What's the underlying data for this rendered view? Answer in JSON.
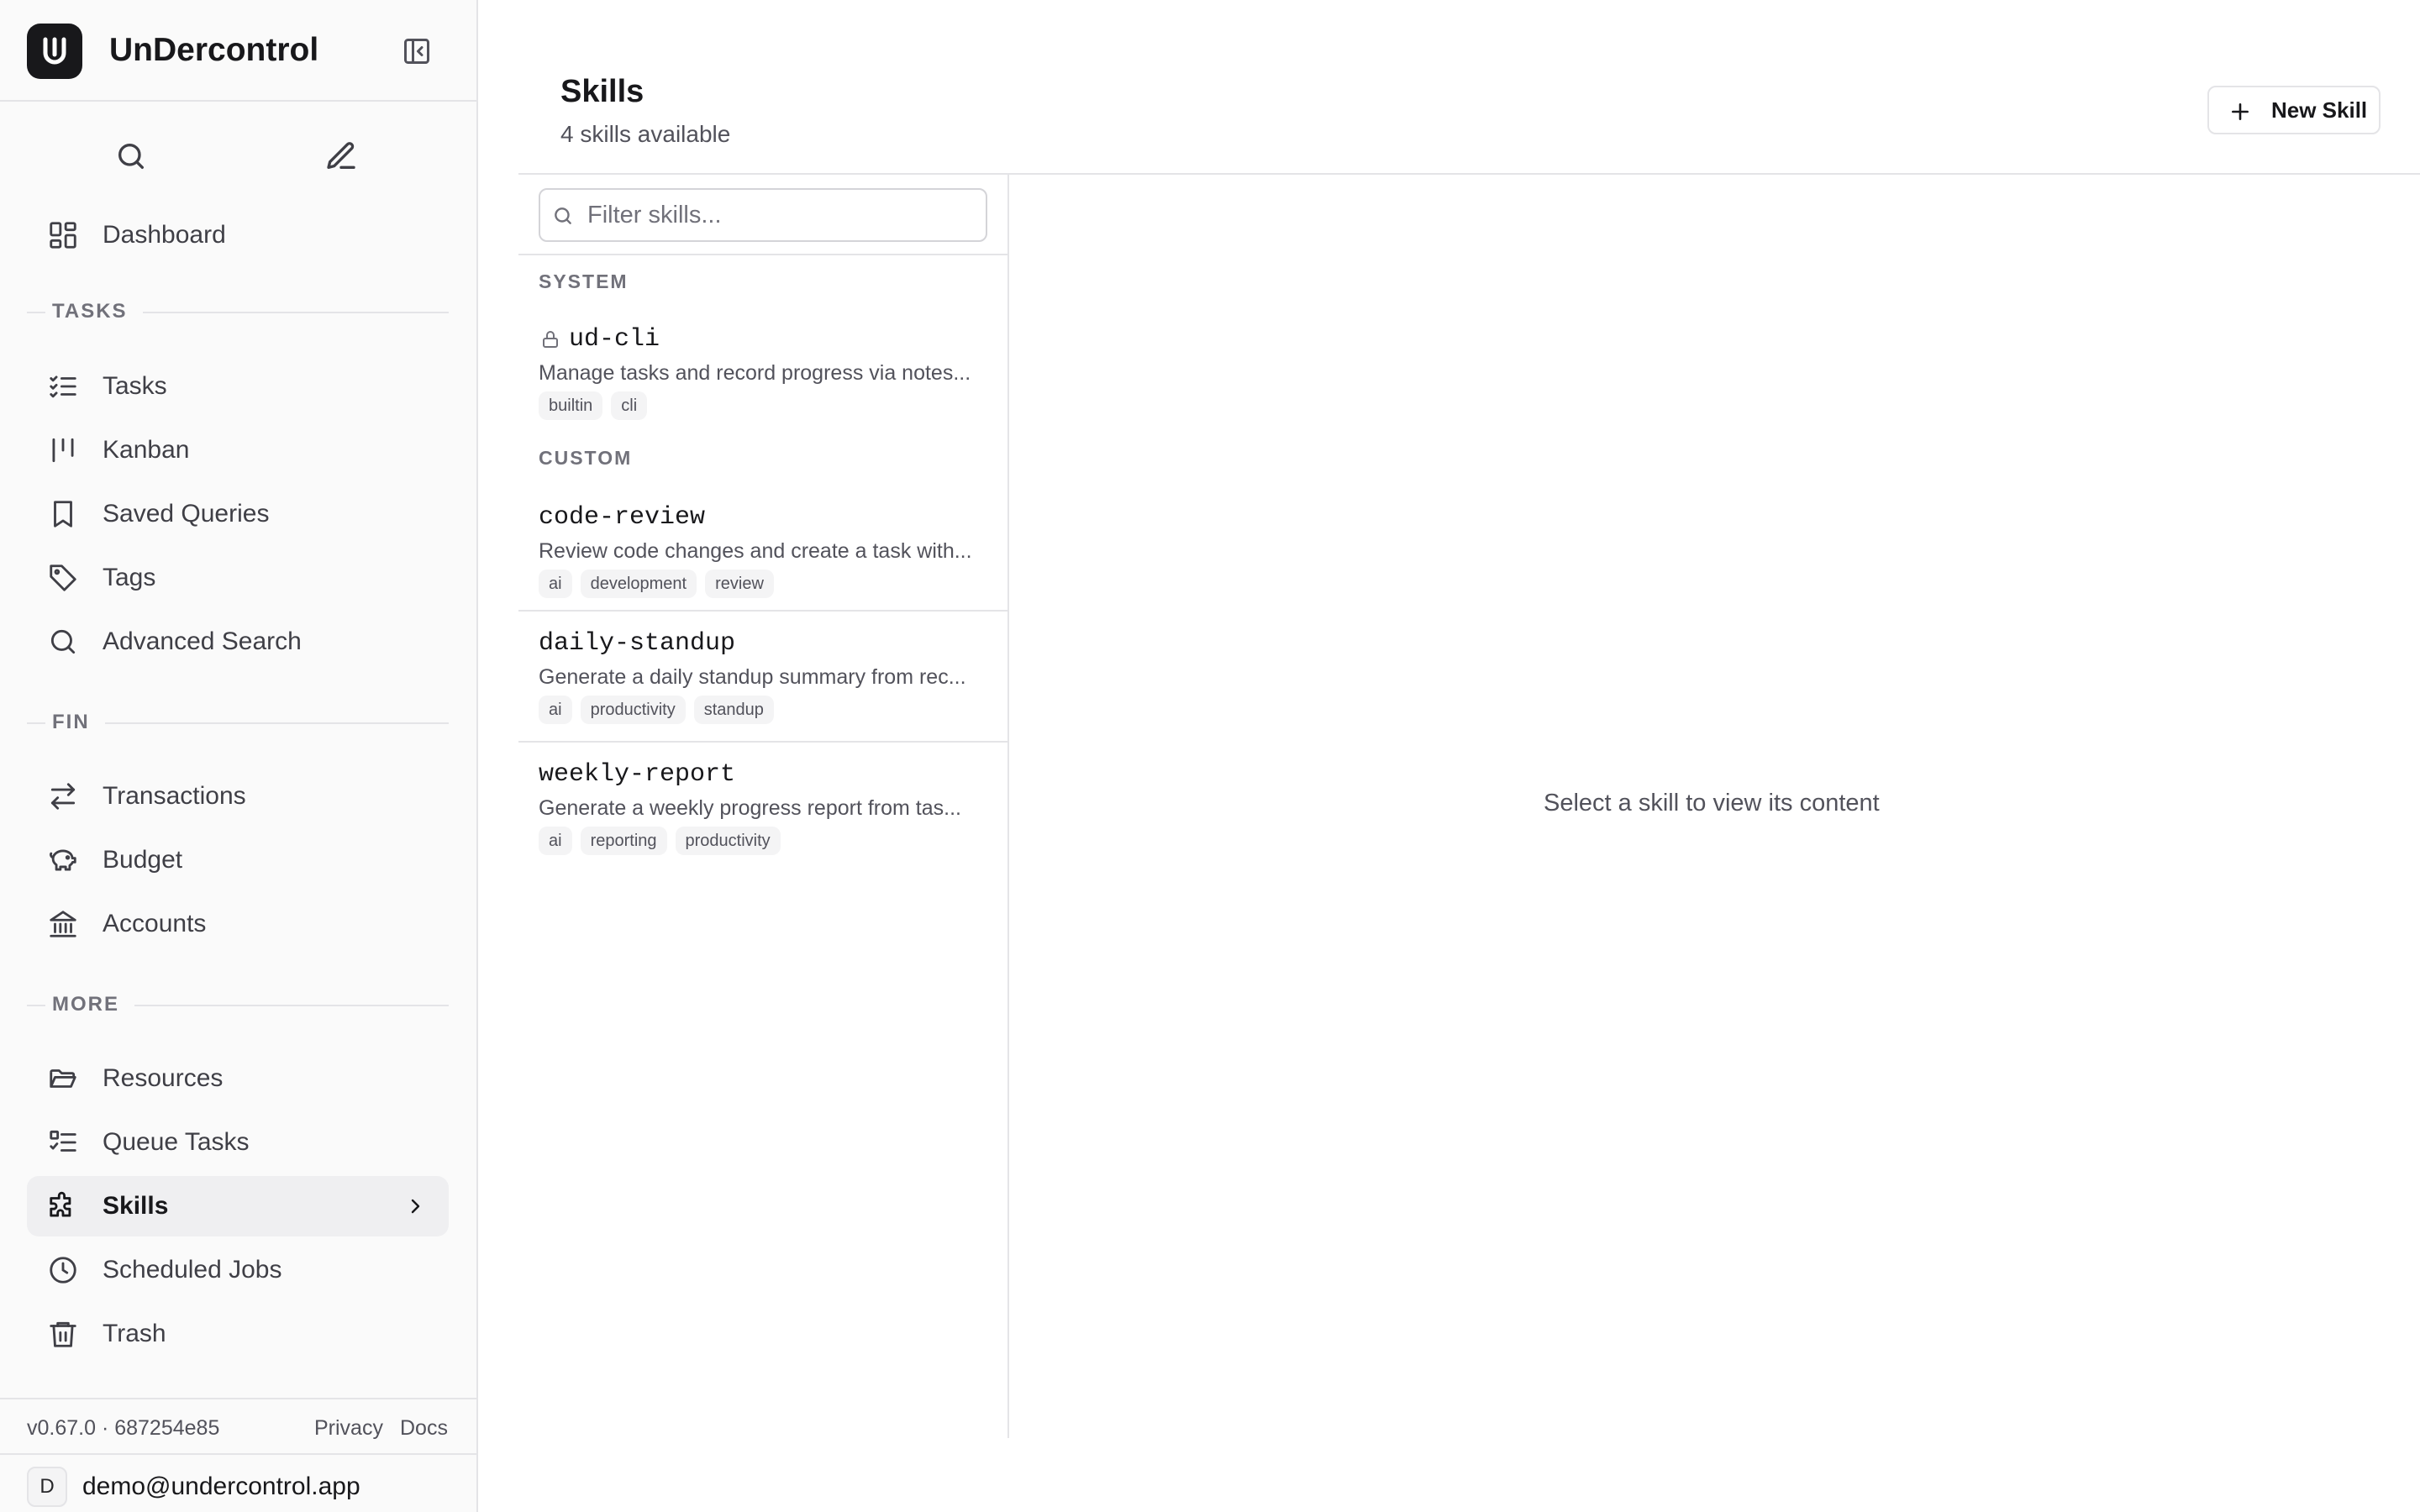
{
  "app": {
    "name": "UnDercontrol",
    "version": "v0.67.0 · 687254e85",
    "privacy_label": "Privacy",
    "docs_label": "Docs",
    "user_initial": "D",
    "user_email": "demo@undercontrol.app"
  },
  "sidebar": {
    "dashboard": "Dashboard",
    "sections": {
      "tasks": "TASKS",
      "fin": "FIN",
      "more": "MORE"
    },
    "tasks_items": [
      "Tasks",
      "Kanban",
      "Saved Queries",
      "Tags",
      "Advanced Search"
    ],
    "fin_items": [
      "Transactions",
      "Budget",
      "Accounts"
    ],
    "more_items": [
      "Resources",
      "Queue Tasks",
      "Skills",
      "Scheduled Jobs",
      "Trash"
    ],
    "active_item": "Skills"
  },
  "page": {
    "title": "Skills",
    "subtitle": "4 skills available",
    "new_button": "New Skill",
    "filter_placeholder": "Filter skills...",
    "empty_message": "Select a skill to view its content"
  },
  "skills": {
    "system_label": "SYSTEM",
    "custom_label": "CUSTOM",
    "system": [
      {
        "name": "ud-cli",
        "desc": "Manage tasks and record progress via notes...",
        "tags": [
          "builtin",
          "cli"
        ]
      }
    ],
    "custom": [
      {
        "name": "code-review",
        "desc": "Review code changes and create a task with...",
        "tags": [
          "ai",
          "development",
          "review"
        ]
      },
      {
        "name": "daily-standup",
        "desc": "Generate a daily standup summary from rec...",
        "tags": [
          "ai",
          "productivity",
          "standup"
        ]
      },
      {
        "name": "weekly-report",
        "desc": "Generate a weekly progress report from tas...",
        "tags": [
          "ai",
          "reporting",
          "productivity"
        ]
      }
    ]
  },
  "colors": {
    "sidebar_bg": "#fafafa",
    "active_bg": "#efeff1",
    "border": "#e4e4e7",
    "text": "#18181b",
    "muted": "#52525b",
    "tag_bg": "#f4f4f5"
  }
}
